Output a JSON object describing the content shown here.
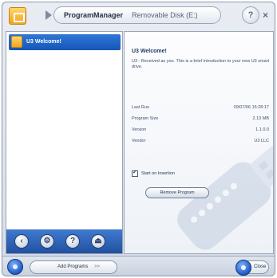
{
  "window": {
    "app_name": "ProgramManager",
    "drive_name": "Removable Disk (E:)",
    "help_label": "?",
    "close_label": "×"
  },
  "sidebar": {
    "items": [
      {
        "label": "U3 Welcome!",
        "selected": true
      }
    ],
    "controls": [
      {
        "icon": "previous-icon"
      },
      {
        "icon": "settings-icon"
      },
      {
        "icon": "help-icon"
      },
      {
        "icon": "eject-icon"
      }
    ]
  },
  "details": {
    "title": "U3 Welcome!",
    "description": "U3 - Received as you. This is a brief introduction to your new U3 smart drive.",
    "rows": [
      {
        "key": "Last Run",
        "value": "09/07/06 15:28:17"
      },
      {
        "key": "Program Size",
        "value": "2.13 MB"
      },
      {
        "key": "Version",
        "value": "1.1.0.0"
      },
      {
        "key": "Vendor",
        "value": "U3 LLC"
      }
    ],
    "startup_label": "Start on Insertion",
    "startup_checked": true,
    "remove_button": "Remove Program"
  },
  "footer": {
    "add_programs": "Add Programs",
    "add_programs_arrow": ">>",
    "close": "Close"
  },
  "colors": {
    "selection": "#1f63c6",
    "sidebar_footer": "#2f66b8",
    "frame": "#d6dde7"
  }
}
